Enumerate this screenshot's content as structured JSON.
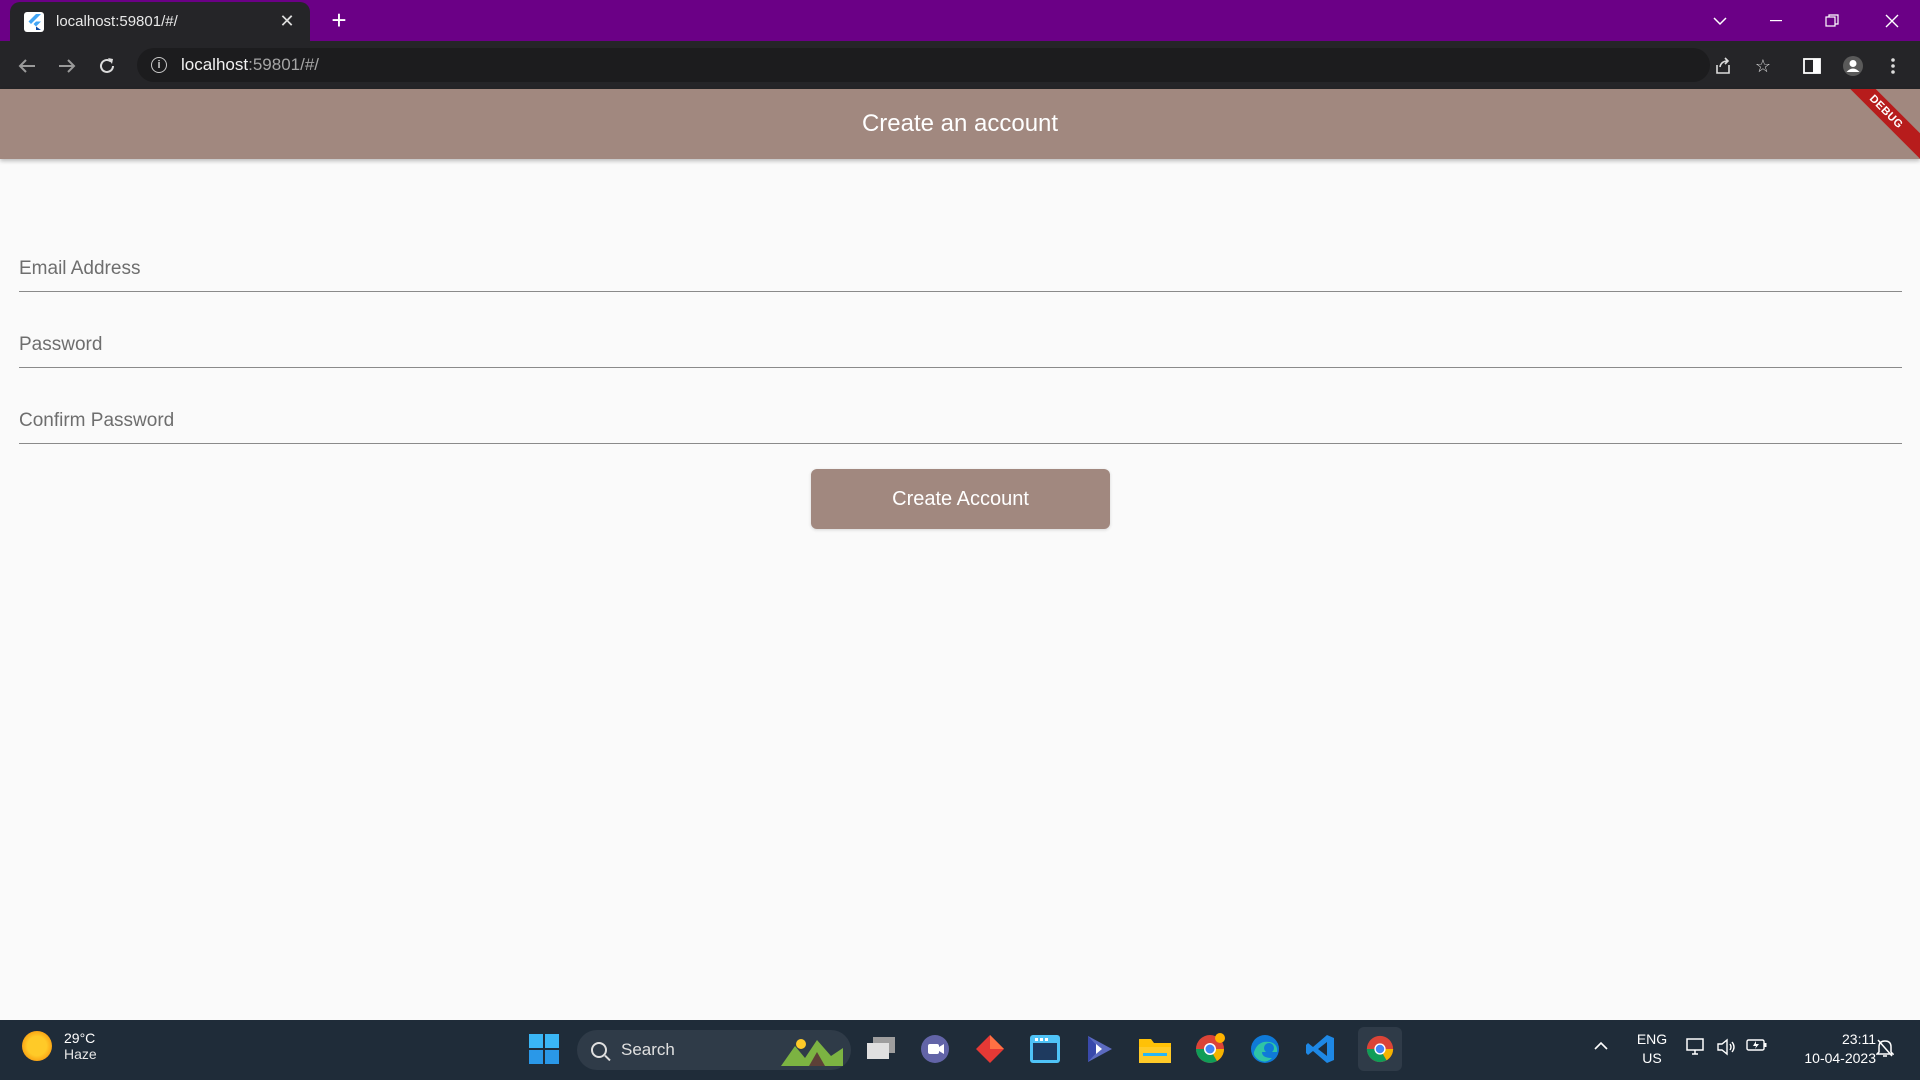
{
  "browser": {
    "tab_title": "localhost:59801/#/",
    "tab_close": "✕",
    "new_tab": "+",
    "url_host": "localhost",
    "url_path": ":59801/#/",
    "icons": [
      "back-icon",
      "forward-icon",
      "reload-icon",
      "site-info-icon",
      "share-icon",
      "bookmark-star-icon",
      "side-panel-icon",
      "profile-icon",
      "menu-icon"
    ]
  },
  "app": {
    "title": "Create an account",
    "debug_banner": "DEBUG",
    "fields": {
      "email_placeholder": "Email Address",
      "password_placeholder": "Password",
      "confirm_placeholder": "Confirm Password"
    },
    "submit_label": "Create Account",
    "colors": {
      "primary": "#a1887f",
      "background": "#fafafa",
      "browser_frame": "#6b0086"
    }
  },
  "taskbar": {
    "weather_temp": "29°C",
    "weather_desc": "Haze",
    "search_label": "Search",
    "lang_line1": "ENG",
    "lang_line2": "US",
    "time": "23:11",
    "date": "10-04-2023"
  }
}
